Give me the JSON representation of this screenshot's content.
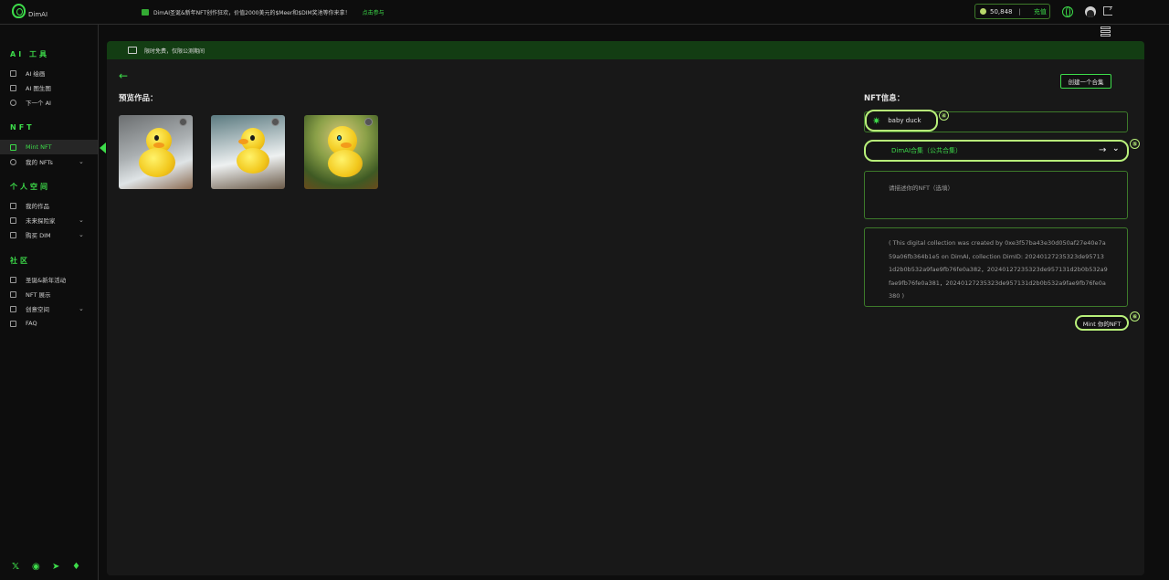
{
  "app": {
    "brand": "DimAI"
  },
  "topbar": {
    "announcement": "DimAI圣诞&新年NFT创作狂欢，价值2000美元的$Meer和$DIM奖池等你来拿！",
    "announcement_link": "点击参与",
    "balance": "50,848",
    "balance_sep": "|",
    "recharge": "充值"
  },
  "sidebar": {
    "sections": [
      {
        "title": "AI 工具",
        "items": [
          {
            "label": "AI 绘画",
            "has_chevron": false
          },
          {
            "label": "AI 图生图",
            "has_chevron": false
          },
          {
            "label": "下一个 AI",
            "has_chevron": false
          }
        ]
      },
      {
        "title": "NFT",
        "items": [
          {
            "label": "Mint NFT",
            "has_chevron": false,
            "active": true
          },
          {
            "label": "我的 NFTs",
            "has_chevron": true
          }
        ]
      },
      {
        "title": "个人空间",
        "items": [
          {
            "label": "我的作品",
            "has_chevron": false
          },
          {
            "label": "未来探险家",
            "has_chevron": true
          },
          {
            "label": "购买 DIM",
            "has_chevron": true
          }
        ]
      },
      {
        "title": "社区",
        "items": [
          {
            "label": "圣诞&新年活动",
            "has_chevron": false
          },
          {
            "label": "NFT 展示",
            "has_chevron": false
          },
          {
            "label": "创意空间",
            "has_chevron": true
          },
          {
            "label": "FAQ",
            "has_chevron": false
          }
        ]
      }
    ],
    "socials": [
      "x-icon",
      "discord-icon",
      "telegram-icon",
      "mic-icon"
    ]
  },
  "main": {
    "banner": "限时免费，仅限公测期间",
    "preview_title": "预览作品：",
    "nft_title": "NFT信息：",
    "create_collection": "创建一个合集",
    "name_value": "baby duck",
    "collection_value": "DimAI合集（公共合集）",
    "collection_arrow": "→",
    "description_placeholder": "请描述你的NFT（选填）",
    "auto_description": "( This digital collection was created by 0xe3f57ba43e30d050af27e40e7a59a06fb364b1e5 on DimAI, collection DimID: 20240127235323de957131d2b0b532a9fae9fb76fe0a382，20240127235323de957131d2b0b532a9fae9fb76fe0a381，20240127235323de957131d2b0b532a9fae9fb76fe0a380 )",
    "mint_button": "Mint 你的NFT",
    "steps": [
      "④",
      "⑤",
      "⑥"
    ]
  },
  "colors": {
    "accent": "#3ddc4a",
    "highlight": "#b8f07a",
    "banner": "#133d13"
  }
}
